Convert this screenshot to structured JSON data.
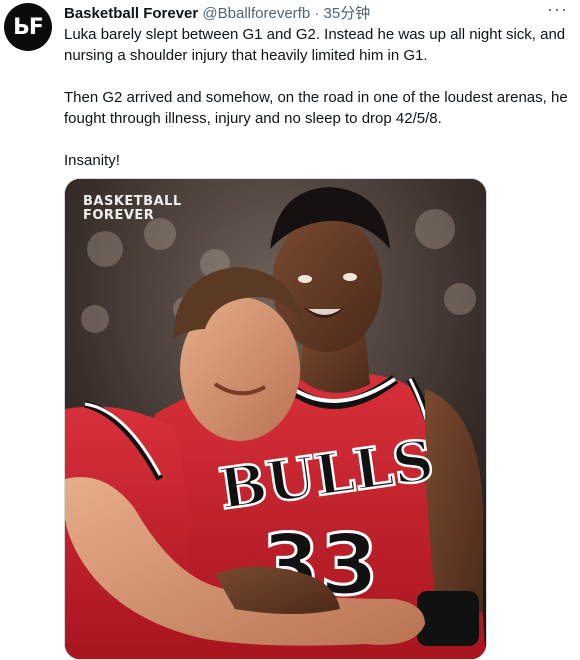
{
  "author": {
    "avatar_text": "ЬF",
    "name": "Basketball Forever",
    "handle": "@Bballforeverfb",
    "separator": "·",
    "time": "35分钟"
  },
  "menu_label": "···",
  "tweet": {
    "paragraphs": [
      "Luka barely slept between G1 and G2. Instead he was up all night sick, and nursing a shoulder injury that heavily limited him in G1.",
      "Then G2 arrived and somehow, on the road in one of the loudest arenas, he fought through illness, injury and no sleep to drop 42/5/8.",
      "Insanity!"
    ]
  },
  "media": {
    "watermark_line1": "BASKETBALL",
    "watermark_line2": "FOREVER",
    "jersey_text": "BULLS",
    "jersey_number": "33"
  }
}
